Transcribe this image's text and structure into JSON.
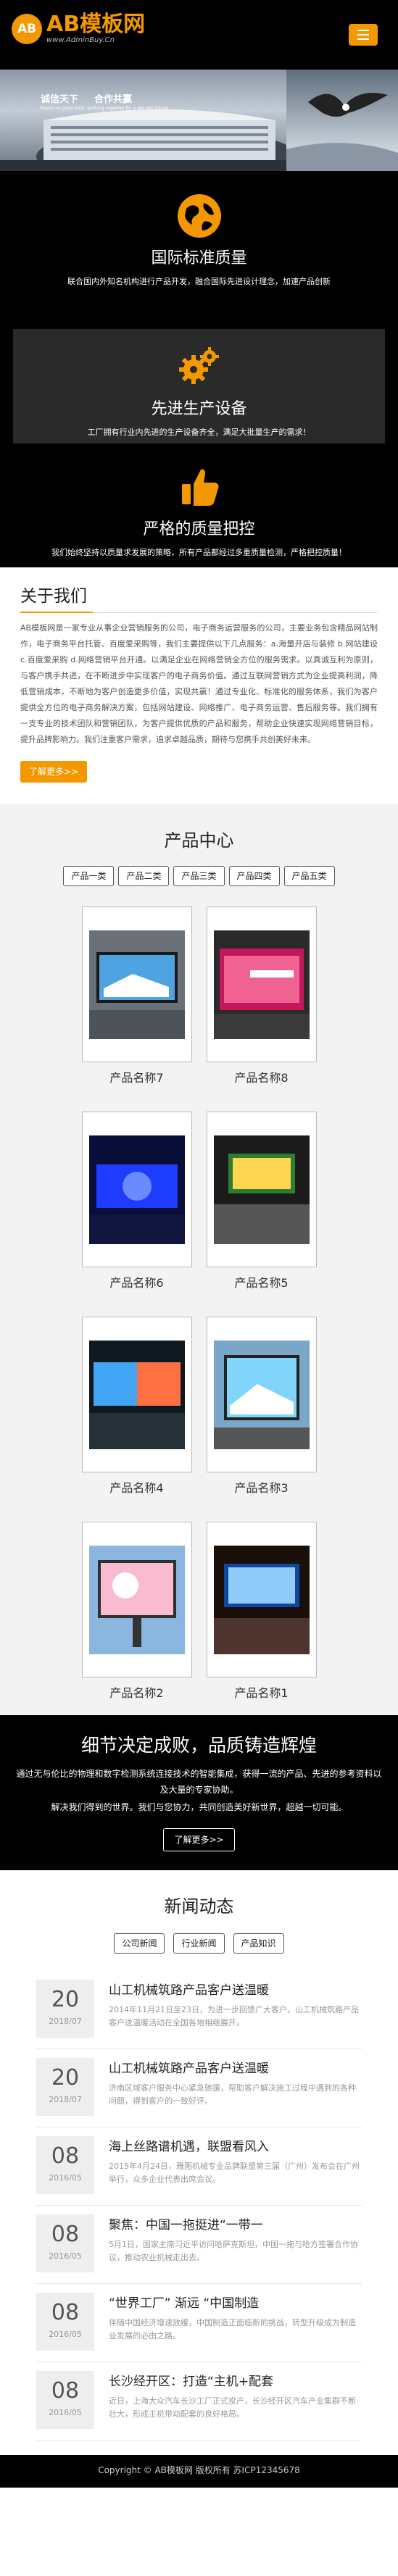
{
  "header": {
    "logo_mark": "AB",
    "logo_name": "AB模板网",
    "logo_url": "www.AdminBuy.Cn"
  },
  "banner": {
    "title_a": "诚信天下",
    "title_b": "合作共赢",
    "subtitle": "Based on good faith, working together for a win-win future"
  },
  "features": [
    {
      "title": "国际标准质量",
      "desc": "联合国内外知名机构进行产品开发，融合国际先进设计理念，加速产品创新"
    },
    {
      "title": "先进生产设备",
      "desc": "工厂拥有行业内先进的生产设备齐全，满足大批量生产的需求！"
    },
    {
      "title": "严格的质量把控",
      "desc": "我们始终坚持以质量求发展的策略，所有产品都经过多重质量检测，严格把控质量！"
    }
  ],
  "about": {
    "title": "关于我们",
    "text": "AB模板网是一家专业从事企业营销服务的公司，电子商务运营服务的公司，主要业务包含精品网站制作，电子商务平台托管、百度爱采购等，我们主要提供以下几点服务：a.海量开店与装修 b.网站建设 c.百度爱采购 d.网络营销平台开通。以满足企业在网络营销全方位的服务需求。以真诚互利为原则，与客户携手共进，在不断进步中实现客户的电子商务价值。通过互联网营销方式为企业提高利润，降低营销成本，不断地为客户创造更多价值，实现共赢！通过专业化、标准化的服务体系，我们为客户提供全方位的电子商务解决方案，包括网站建设、网络推广、电子商务运营、售后服务等。我们拥有一支专业的技术团队和营销团队，为客户提供优质的产品和服务，帮助企业快速实现网络营销目标，提升品牌影响力。我们注重客户需求，追求卓越品质，期待与您携手共创美好未来。",
    "button": "了解更多>>"
  },
  "products": {
    "title": "产品中心",
    "tabs": [
      "产品一类",
      "产品二类",
      "产品三类",
      "产品四类",
      "产品五类"
    ],
    "items": [
      "产品名称7",
      "产品名称8",
      "产品名称6",
      "产品名称5",
      "产品名称4",
      "产品名称3",
      "产品名称2",
      "产品名称1"
    ]
  },
  "slogan": {
    "title": "细节决定成败，品质铸造辉煌",
    "text1": "通过无与伦比的物理和数字检测系统连接技术的智能集成，获得一流的产品、先进的参考资料以及大量的专家协助。",
    "text2": "解决我们得到的世界。我们与您协力，共同创造美好新世界，超越一切可能。",
    "button": "了解更多>>"
  },
  "news": {
    "title": "新闻动态",
    "tabs": [
      "公司新闻",
      "行业新闻",
      "产品知识"
    ],
    "items": [
      {
        "day": "20",
        "ym": "2018/07",
        "title": "山工机械筑路产品客户送温暖",
        "desc": "2014年11月21日至23日，为进一步回馈广大客户，山工机械筑路产品客户送温暖活动在全国各地相继展开。"
      },
      {
        "day": "20",
        "ym": "2018/07",
        "title": "山工机械筑路产品客户送温暖",
        "desc": "济南区域客户服务中心紧急驰援，帮助客户解决施工过程中遇到的各种问题，得到客户的一致好评。"
      },
      {
        "day": "08",
        "ym": "2016/05",
        "title": "海上丝路谱机遇，联盟看风入",
        "desc": "2015年4月24日，雅图机械专业品牌联盟第三届（广州）发布会在广州举行，众多企业代表出席会议。"
      },
      {
        "day": "08",
        "ym": "2016/05",
        "title": "聚焦：中国一拖挺进“一带一",
        "desc": "5月1日，国家主席习近平访问哈萨克斯坦，中国一拖与哈方签署合作协议，推动农业机械走出去。"
      },
      {
        "day": "08",
        "ym": "2016/05",
        "title": "“世界工厂” 渐远 “中国制造",
        "desc": "伴随中国经济增速放缓，中国制造正面临新的挑战，转型升级成为制造业发展的必由之路。"
      },
      {
        "day": "08",
        "ym": "2016/05",
        "title": "长沙经开区：打造“主机+配套",
        "desc": "近日，上海大众汽车长沙工厂正式投产，长沙经开区汽车产业集群不断壮大，形成主机带动配套的良好格局。"
      }
    ]
  },
  "footer": {
    "text": "Copyright © AB模板网 版权所有   苏ICP12345678"
  },
  "colors": {
    "accent": "#f39800",
    "dark": "#000000"
  }
}
